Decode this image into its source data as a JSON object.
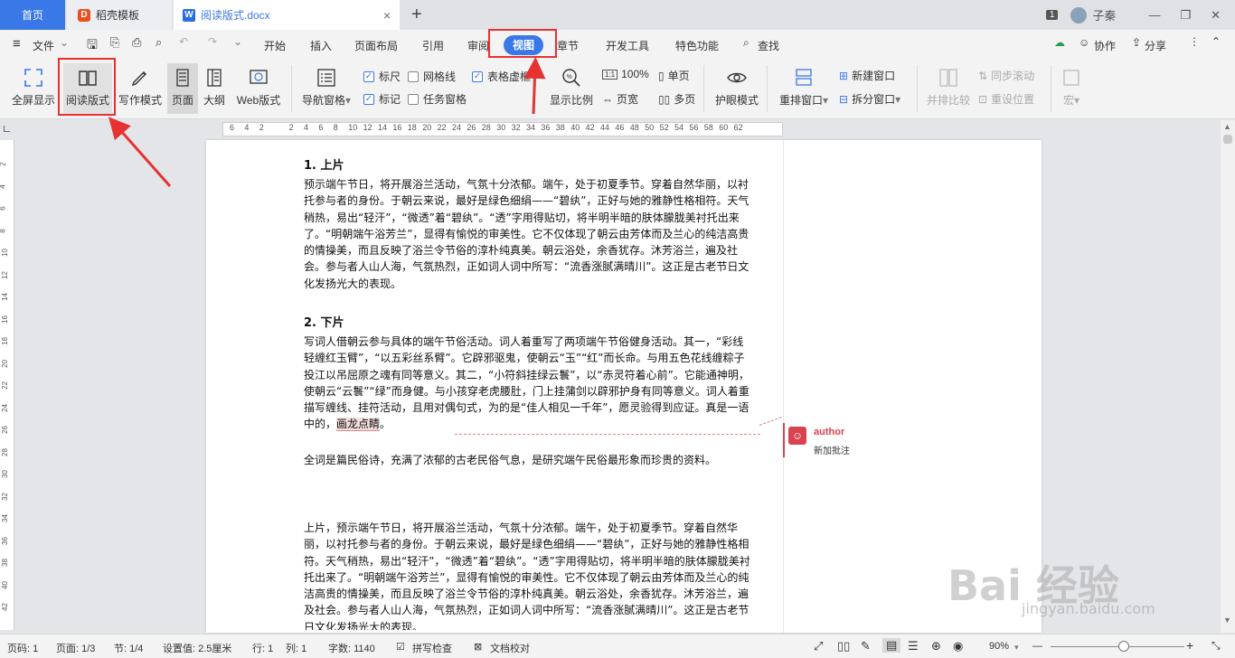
{
  "tabs": {
    "home": "首页",
    "template": "稻壳模板",
    "template_badge": "D",
    "doc": "阅读版式.docx",
    "doc_badge": "W",
    "close": "×",
    "new_tab": "+"
  },
  "window": {
    "badge": "1",
    "user": "子秦",
    "min": "—",
    "restore": "❐",
    "close": "✕"
  },
  "menubar": {
    "hamburger": "≡",
    "file": "文件",
    "items": [
      "开始",
      "插入",
      "页面布局",
      "引用",
      "审阅",
      "视图",
      "章节",
      "开发工具",
      "特色功能"
    ],
    "active": "视图",
    "search": "查找",
    "collab": "协作",
    "share": "分享"
  },
  "ribbon": {
    "fullscreen": "全屏显示",
    "reading": "阅读版式",
    "writing": "写作模式",
    "page": "页面",
    "outline": "大纲",
    "web": "Web版式",
    "nav_pane": "导航窗格",
    "ruler": "标尺",
    "gridlines": "网格线",
    "table_gridlines": "表格虚框",
    "marks": "标记",
    "task_pane": "任务窗格",
    "zoom": "显示比例",
    "zoom_100": "100%",
    "page_width": "页宽",
    "single_page": "单页",
    "multi_page": "多页",
    "eye_mode": "护眼模式",
    "rearrange": "重排窗口",
    "new_window": "新建窗口",
    "split_window": "拆分窗口",
    "side_by_side": "并排比较",
    "sync_scroll": "同步滚动",
    "reset_pos": "重设位置",
    "macro": "宏"
  },
  "ruler": {
    "ticks": [
      "6",
      "4",
      "2",
      "",
      "2",
      "4",
      "6",
      "8",
      "10",
      "12",
      "14",
      "16",
      "18",
      "20",
      "22",
      "24",
      "26",
      "28",
      "30",
      "32",
      "34",
      "36",
      "38",
      "40",
      "42",
      "44",
      "46",
      "48",
      "50",
      "52",
      "54",
      "56",
      "58",
      "60",
      "62"
    ]
  },
  "vruler": {
    "ticks": [
      "2",
      "4",
      "6",
      "8",
      "10",
      "12",
      "14",
      "16",
      "18",
      "20",
      "22",
      "24",
      "26",
      "28",
      "30",
      "32",
      "34",
      "36",
      "38",
      "40",
      "42"
    ]
  },
  "document": {
    "h1": "1.  上片",
    "p1": "预示端午节日，将开展浴兰活动，气氛十分浓郁。端午，处于初夏季节。穿着自然华丽，以衬托参与者的身份。于朝云来说，最好是绿色细绢——“碧纨”，正好与她的雅静性格相符。天气稍热，易出“轻汗”，“微透”着“碧纨”。“透”字用得贴切，将半明半暗的肤体朦胧美衬托出来了。“明朝端午浴芳兰”，显得有愉悦的审美性。它不仅体现了朝云由芳体而及兰心的纯洁高贵的情操美，而且反映了浴兰令节俗的淳朴纯真美。朝云浴处，余香犹存。沐芳浴兰，遍及社会。参与者人山人海，气氛热烈，正如词人词中所写：“流香涨腻满晴川”。这正是古老节日文化发扬光大的表现。",
    "h2": "2.  下片",
    "p2_before": "写词人借朝云参与具体的端午节俗活动。词人着重写了两项端午节俗健身活动。其一，“彩线轻缠红玉臂”，“以五彩丝系臂”。它辟邪驱鬼，使朝云“玉”“红”而长命。与用五色花线缠粽子投江以吊屈原之魂有同等意义。其二，“小符斜挂绿云鬟”，以“赤灵符着心前”。它能通神明，使朝云“云鬟”“绿”而身健。与小孩穿老虎腰肚，门上挂蒲剑以辟邪护身有同等意义。词人着重描写缠线、挂符活动，且用对偶句式，为的是“佳人相见一千年”，愿灵验得到应证。真是一语中的，",
    "p2_highlight": "画龙点睛",
    "p2_after": "。",
    "p3": "全词是篇民俗诗，充满了浓郁的古老民俗气息，是研究端午民俗最形象而珍贵的资料。",
    "p4": "上片，预示端午节日，将开展浴兰活动，气氛十分浓郁。端午，处于初夏季节。穿着自然华丽，以衬托参与者的身份。于朝云来说，最好是绿色细绢——“碧纨”，正好与她的雅静性格相符。天气稍热，易出“轻汗”，“微透”着“碧纨”。“透”字用得贴切，将半明半暗的肤体朦胧美衬托出来了。“明朝端午浴芳兰”，显得有愉悦的审美性。它不仅体现了朝云由芳体而及兰心的纯洁高贵的情操美，而且反映了浴兰令节俗的淳朴纯真美。朝云浴处，余香犹存。沐芳浴兰，遍及社会。参与者人山人海，气氛热烈，正如词人词中所写：“流香涨腻满晴川”。这正是古老节日文化发扬光大的表现。"
  },
  "comment": {
    "author": "author",
    "text": "新加批注"
  },
  "status": {
    "page_no": "页码: 1",
    "page": "页面: 1/3",
    "section": "节: 1/4",
    "setting": "设置值: 2.5厘米",
    "row": "行: 1",
    "col": "列: 1",
    "words": "字数: 1140",
    "spell": "拼写检查",
    "proof": "文档校对",
    "zoom": "90%",
    "zoom_minus": "—",
    "zoom_plus": "+",
    "zoom_level": 0.55
  },
  "watermark": {
    "text": "Bai 经验",
    "sub": "jingyan.baidu.com"
  },
  "colors": {
    "accent": "#3b78e7",
    "annotation": "#e63232",
    "comment": "#d9434f"
  }
}
